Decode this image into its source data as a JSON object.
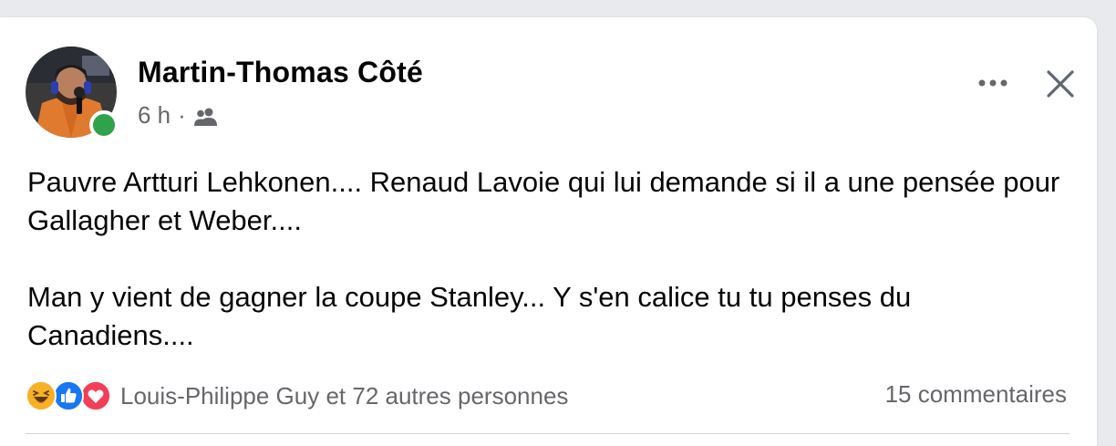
{
  "post": {
    "author": "Martin-Thomas Côté",
    "time": "6 h",
    "separator": "·",
    "audience_icon": "friends-icon",
    "text_paragraphs": [
      "Pauvre Artturi Lehkonen.... Renaud Lavoie qui lui demande si il a une pensée pour Gallagher et Weber....",
      "Man y vient de gagner la coupe Stanley... Y s'en calice tu tu penses du Canadiens...."
    ],
    "reactions": {
      "icons": [
        "haha-icon",
        "like-icon",
        "love-icon"
      ],
      "summary": "Louis-Philippe Guy et 72 autres personnes"
    },
    "comments": "15 commentaires"
  },
  "colors": {
    "online": "#31a24c",
    "like": "#1877f2",
    "love": "#f33e58",
    "haha": "#f7b125",
    "secondary_text": "#65676b"
  }
}
